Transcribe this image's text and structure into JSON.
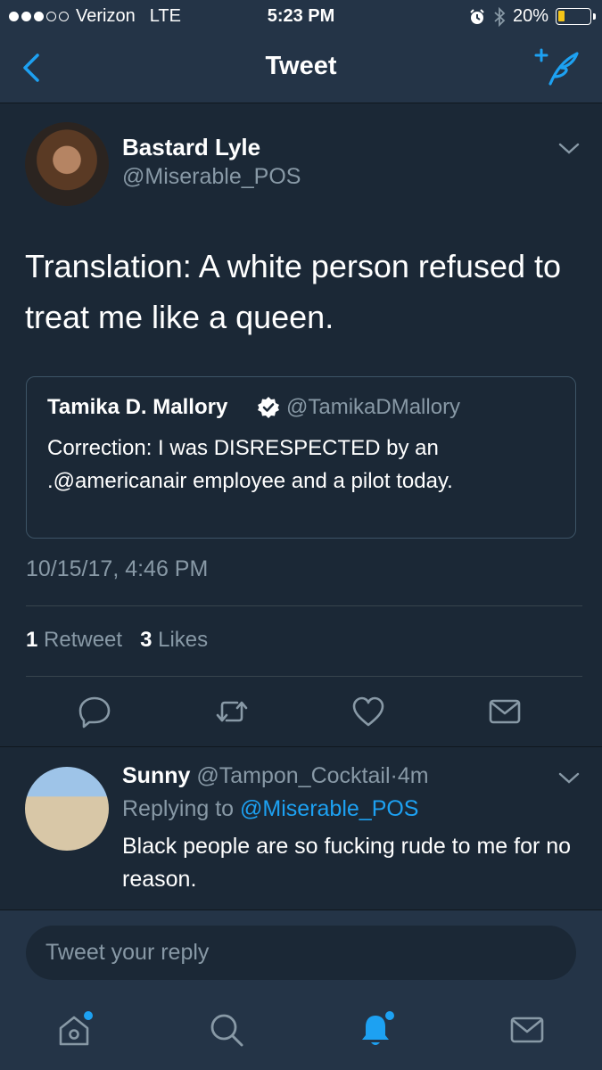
{
  "status_bar": {
    "carrier": "Verizon",
    "network": "LTE",
    "time": "5:23 PM",
    "battery_percent": "20%",
    "battery_level": 0.2
  },
  "nav": {
    "title": "Tweet",
    "back_icon": "chevron-left-icon",
    "compose_icon": "compose-tweet-icon"
  },
  "tweet": {
    "display_name": "Bastard Lyle",
    "handle": "@Miserable_POS",
    "text": "Translation: A white person refused to treat me like a queen.",
    "quote": {
      "display_name": "Tamika D. Mallory",
      "handle": "@TamikaDMallory",
      "text": "Correction: I was DISRESPECTED by an .@americanair employee and a pilot today."
    },
    "timestamp": "10/15/17, 4:46 PM",
    "retweet_count": "1",
    "retweet_label": "Retweet",
    "like_count": "3",
    "like_label": "Likes"
  },
  "actions": [
    "reply-icon",
    "retweet-icon",
    "like-icon",
    "direct-message-icon"
  ],
  "reply": {
    "display_name": "Sunny",
    "handle": "@Tampon_Cocktail",
    "separator": "·",
    "time": "4m",
    "replying_label": "Replying to",
    "replying_to": "@Miserable_POS",
    "text": "Black people are so fucking rude to me for no reason."
  },
  "composer": {
    "placeholder": "Tweet your reply"
  },
  "tabs": [
    "home-icon",
    "search-icon",
    "notifications-icon",
    "messages-icon"
  ],
  "colors": {
    "background": "#1b2836",
    "bar": "#243447",
    "accent": "#1da1f2",
    "secondary_text": "#8899a6",
    "battery_fill": "#f5c518"
  }
}
